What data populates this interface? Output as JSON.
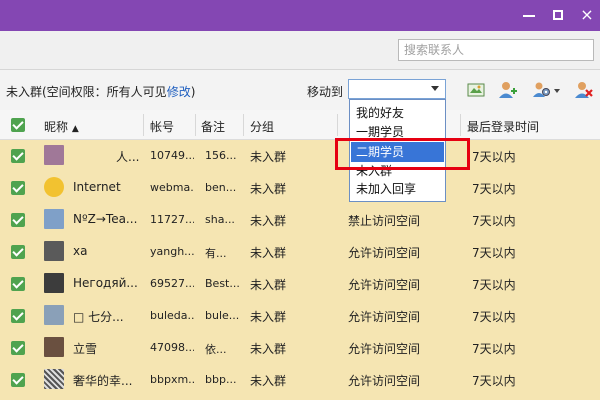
{
  "window": {
    "minimize": "minimize",
    "maximize": "maximize",
    "close_glyph": "×"
  },
  "search": {
    "placeholder": "搜索联系人"
  },
  "toolbar": {
    "group_info_prefix": "未入群(空间权限：所有人可见",
    "modify_link": "修改",
    "group_info_suffix": ")",
    "move_to_label": "移动到",
    "icons": [
      "message-icon",
      "add-user-icon",
      "manage-users-icon",
      "remove-user-icon"
    ]
  },
  "columns": {
    "nickname": "昵称",
    "sort_glyph": "▲",
    "account": "帐号",
    "remark": "备注",
    "group": "分组",
    "last_login": "最后登录时间"
  },
  "dropdown": {
    "options": [
      "我的好友",
      "一期学员",
      "二期学员",
      "未入群",
      "未加入回享"
    ],
    "highlighted_index": 2
  },
  "rows": [
    {
      "nick": "人...",
      "account": "10749...",
      "remark": "156...",
      "group": "未入群",
      "permission": "",
      "last": "7天以内",
      "avatar_color": "#a07898"
    },
    {
      "nick": "Internet",
      "account": "webma...",
      "remark": "ben...",
      "group": "未入群",
      "permission": "",
      "last": "7天以内",
      "avatar_color": "#f2c230"
    },
    {
      "nick": "NºZ→Tea...",
      "account": "11727...",
      "remark": "sha...",
      "group": "未入群",
      "permission": "禁止访问空间",
      "last": "7天以内",
      "avatar_color": "#7fa0c8"
    },
    {
      "nick": "xa",
      "account": "yangh...",
      "remark": "有...",
      "group": "未入群",
      "permission": "允许访问空间",
      "last": "7天以内",
      "avatar_color": "#5a5a5a"
    },
    {
      "nick": "Негодяй...",
      "account": "69527...",
      "remark": "Best...",
      "group": "未入群",
      "permission": "允许访问空间",
      "last": "7天以内",
      "avatar_color": "#3c3c3c"
    },
    {
      "nick": "□  七分...",
      "account": "buleda...",
      "remark": "bule...",
      "group": "未入群",
      "permission": "允许访问空间",
      "last": "7天以内",
      "avatar_color": "#8aa0b8"
    },
    {
      "nick": "立雪",
      "account": "47098...",
      "remark": "依...",
      "group": "未入群",
      "permission": "允许访问空间",
      "last": "7天以内",
      "avatar_color": "#6a5040"
    },
    {
      "nick": "奢华的幸...",
      "account": "bbpxm...",
      "remark": "bbp...",
      "group": "未入群",
      "permission": "允许访问空间",
      "last": "7天以内",
      "avatar_color": "#888888"
    }
  ],
  "colors": {
    "titlebar": "#8447b3",
    "row_bg": "#f5e5b2",
    "checkbox": "#4fa34f",
    "selection": "#3875d7",
    "highlight": "#e60012"
  }
}
